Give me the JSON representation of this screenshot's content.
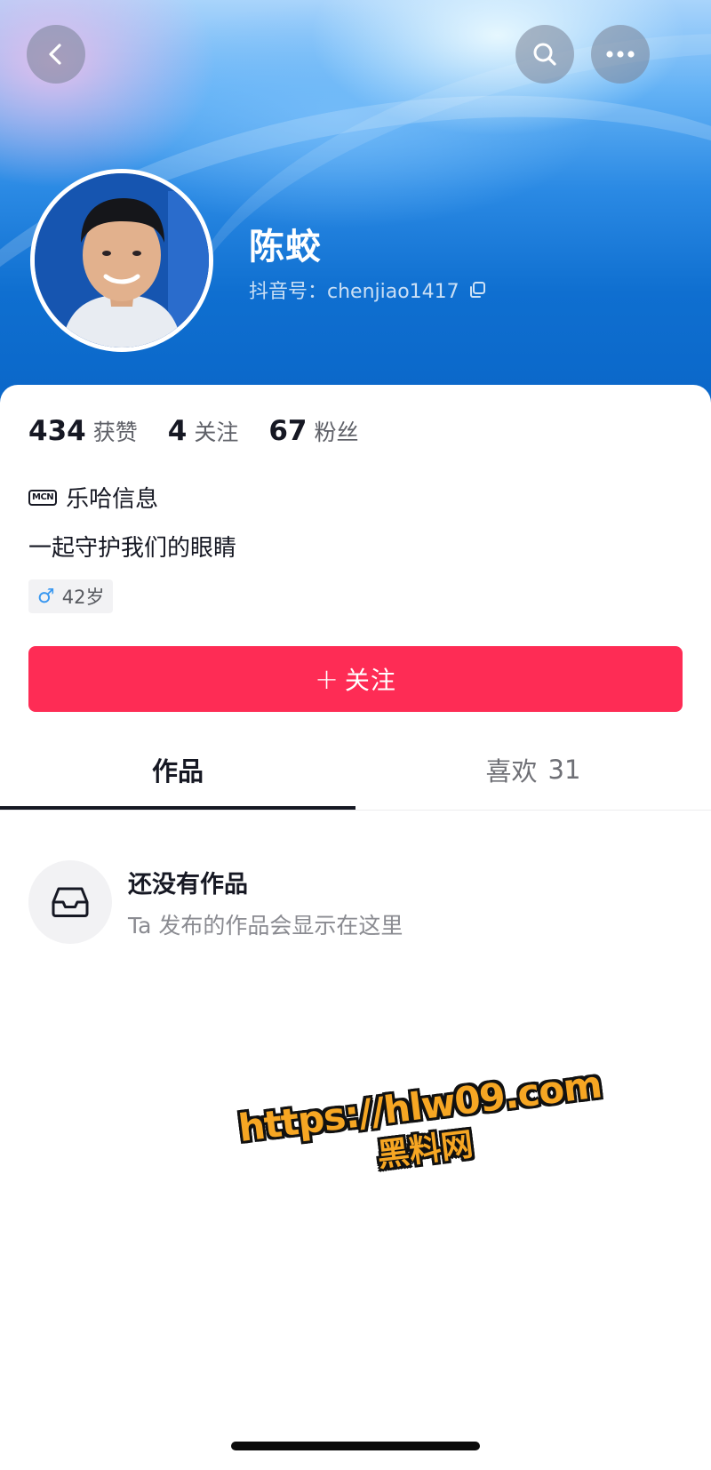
{
  "header": {
    "back_icon": "chevron-left-icon",
    "search_icon": "search-icon",
    "more_icon": "more-dots-icon"
  },
  "profile": {
    "name": "陈蛟",
    "douyin_id": "抖音号：chenjiao1417",
    "copy_icon": "copy-icon"
  },
  "stats": [
    {
      "value": "434",
      "label": "获赞"
    },
    {
      "value": "4",
      "label": "关注"
    },
    {
      "value": "67",
      "label": "粉丝"
    }
  ],
  "org": {
    "badge": "MCN",
    "name": "乐哈信息"
  },
  "bio": "一起守护我们的眼睛",
  "age_tag": {
    "symbol": "♂",
    "text": "42岁"
  },
  "follow_button": {
    "plus": "+",
    "label": "关注"
  },
  "tabs": [
    {
      "label": "作品",
      "count": ""
    },
    {
      "label": "喜欢",
      "count": "31"
    }
  ],
  "empty_state": {
    "icon": "inbox-icon",
    "title": "还没有作品",
    "subtitle": "Ta 发布的作品会显示在这里"
  },
  "watermark": {
    "url": "https://hlw09.com",
    "name": "黑料网"
  },
  "colors": {
    "accent": "#fe2c55",
    "banner": "#0f6fd0",
    "male": "#3a98f0"
  }
}
